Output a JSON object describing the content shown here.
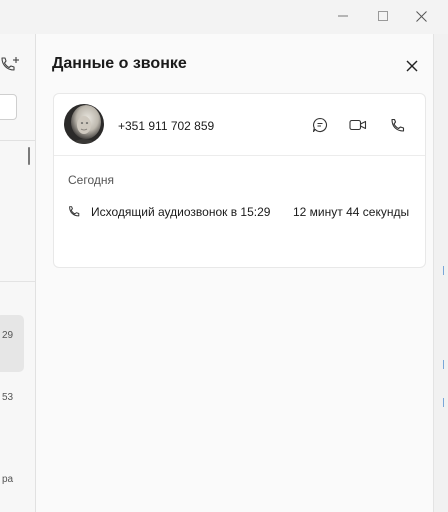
{
  "window": {
    "controls": {
      "minimize_icon": "minimize-icon",
      "maximize_icon": "maximize-icon"
    }
  },
  "left_pane": {
    "snippets": [
      "29",
      "53",
      "ра"
    ]
  },
  "details": {
    "title": "Данные о звонке",
    "contact": {
      "phone": "+351 911 702 859"
    },
    "actions": [
      "chat-icon",
      "video-call-icon",
      "audio-call-icon"
    ],
    "day_label": "Сегодня",
    "call": {
      "description": "Исходящий аудиозвонок в 15:29",
      "duration": "12 минут 44 секунды"
    }
  },
  "colors": {
    "background": "#f3f3f3",
    "panel": "#fafafa",
    "card": "#ffffff",
    "text": "#1b1b1b",
    "secondary_text": "#555555"
  }
}
